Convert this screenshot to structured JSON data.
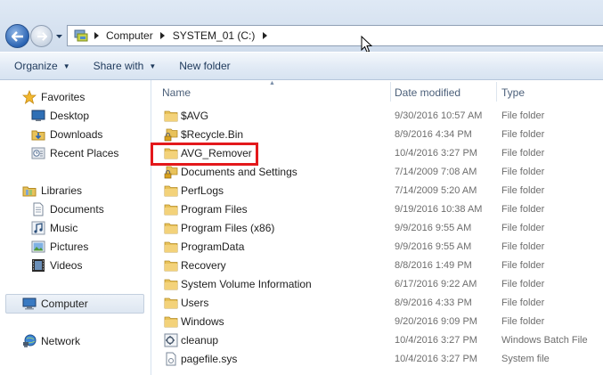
{
  "address_bar": {
    "breadcrumbs": [
      "Computer",
      "SYSTEM_01 (C:)"
    ]
  },
  "toolbar": {
    "organize_label": "Organize",
    "share_label": "Share with",
    "new_folder_label": "New folder"
  },
  "navpane": {
    "favorites": {
      "label": "Favorites",
      "items": [
        {
          "label": "Desktop",
          "icon": "desktop-icon"
        },
        {
          "label": "Downloads",
          "icon": "downloads-icon"
        },
        {
          "label": "Recent Places",
          "icon": "recent-places-icon"
        }
      ]
    },
    "libraries": {
      "label": "Libraries",
      "items": [
        {
          "label": "Documents",
          "icon": "documents-icon"
        },
        {
          "label": "Music",
          "icon": "music-icon"
        },
        {
          "label": "Pictures",
          "icon": "pictures-icon"
        },
        {
          "label": "Videos",
          "icon": "videos-icon"
        }
      ]
    },
    "computer": {
      "label": "Computer"
    },
    "network": {
      "label": "Network"
    }
  },
  "columns": {
    "name": "Name",
    "date": "Date modified",
    "type": "Type"
  },
  "files": [
    {
      "name": "$AVG",
      "date": "9/30/2016 10:57 AM",
      "type": "File folder",
      "icon": "folder"
    },
    {
      "name": "$Recycle.Bin",
      "date": "8/9/2016 4:34 PM",
      "type": "File folder",
      "icon": "locked-folder"
    },
    {
      "name": "AVG_Remover",
      "date": "10/4/2016 3:27 PM",
      "type": "File folder",
      "icon": "folder"
    },
    {
      "name": "Documents and Settings",
      "date": "7/14/2009 7:08 AM",
      "type": "File folder",
      "icon": "locked-folder"
    },
    {
      "name": "PerfLogs",
      "date": "7/14/2009 5:20 AM",
      "type": "File folder",
      "icon": "folder"
    },
    {
      "name": "Program Files",
      "date": "9/19/2016 10:38 AM",
      "type": "File folder",
      "icon": "folder"
    },
    {
      "name": "Program Files (x86)",
      "date": "9/9/2016 9:55 AM",
      "type": "File folder",
      "icon": "folder"
    },
    {
      "name": "ProgramData",
      "date": "9/9/2016 9:55 AM",
      "type": "File folder",
      "icon": "folder"
    },
    {
      "name": "Recovery",
      "date": "8/8/2016 1:49 PM",
      "type": "File folder",
      "icon": "folder"
    },
    {
      "name": "System Volume Information",
      "date": "6/17/2016 9:22 AM",
      "type": "File folder",
      "icon": "folder"
    },
    {
      "name": "Users",
      "date": "8/9/2016 4:33 PM",
      "type": "File folder",
      "icon": "folder"
    },
    {
      "name": "Windows",
      "date": "9/20/2016 9:09 PM",
      "type": "File folder",
      "icon": "folder"
    },
    {
      "name": "cleanup",
      "date": "10/4/2016 3:27 PM",
      "type": "Windows Batch File",
      "icon": "batch-file"
    },
    {
      "name": "pagefile.sys",
      "date": "10/4/2016 3:27 PM",
      "type": "System file",
      "icon": "system-file"
    }
  ],
  "colors": {
    "highlight": "#e3181b",
    "folder": "#e8c25a"
  }
}
